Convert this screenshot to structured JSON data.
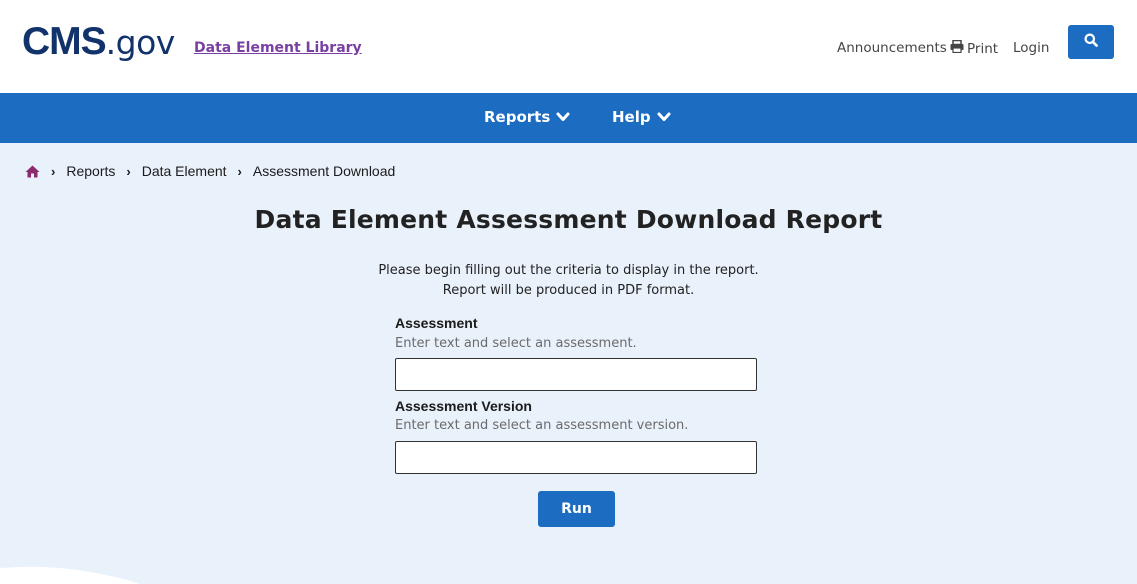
{
  "header": {
    "logo_main": "CMS",
    "logo_suffix": ".gov",
    "library_link": "Data Element Library",
    "util_links": {
      "announcements": "Announcements",
      "print": "Print",
      "login": "Login"
    },
    "icons": {
      "print": "printer-icon",
      "search": "search-icon"
    }
  },
  "nav": {
    "items": [
      {
        "label": "Reports",
        "icon": "chevron-down-icon"
      },
      {
        "label": "Help",
        "icon": "chevron-down-icon"
      }
    ]
  },
  "breadcrumb": {
    "home_icon": "home-icon",
    "items": [
      "Reports",
      "Data Element",
      "Assessment Download"
    ]
  },
  "page": {
    "title": "Data Element Assessment Download Report",
    "intro_line1": "Please begin filling out the criteria to display in the report.",
    "intro_line2": "Report will be produced in PDF format."
  },
  "form": {
    "assessment": {
      "label": "Assessment",
      "hint": "Enter text and select an assessment.",
      "value": ""
    },
    "assessment_version": {
      "label": "Assessment Version",
      "hint": "Enter text and select an assessment version.",
      "value": ""
    },
    "run_label": "Run"
  },
  "colors": {
    "brand_navy": "#12326b",
    "primary_blue": "#1c6cc2",
    "link_purple": "#7a3fa3",
    "page_background": "#e9f1fb"
  }
}
